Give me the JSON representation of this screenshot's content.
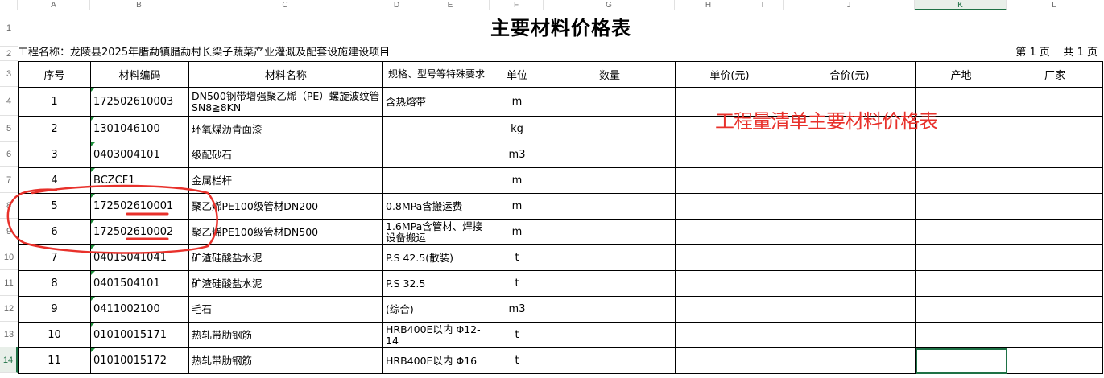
{
  "columns": [
    "A",
    "B",
    "C",
    "D",
    "E",
    "F",
    "G",
    "H",
    "I",
    "J",
    "K",
    "L"
  ],
  "selected_column": "K",
  "rows": [
    "1",
    "2",
    "3",
    "4",
    "5",
    "6",
    "7",
    "8",
    "9",
    "10",
    "11",
    "12",
    "13",
    "14"
  ],
  "selected_row": "14",
  "sheet": {
    "title": "主要材料价格表",
    "project": "工程名称：龙陵县2025年腊勐镇腊勐村长梁子蔬菜产业灌溉及配套设施建设项目",
    "page_info": "第 1 页    共 1 页",
    "headers": {
      "seq": "序号",
      "code": "材料编码",
      "name": "材料名称",
      "spec": "规格、型号等特殊要求",
      "unit": "单位",
      "qty": "数量",
      "price": "单价(元)",
      "total": "合价(元)",
      "origin": "产地",
      "maker": "厂家"
    },
    "items": [
      {
        "seq": "1",
        "code": "172502610003",
        "name": "DN500钢带增强聚乙烯（PE）螺旋波纹管SN8≧8KN",
        "spec": "含热熔带",
        "unit": "m"
      },
      {
        "seq": "2",
        "code": "1301046100",
        "name": "环氧煤沥青面漆",
        "spec": "",
        "unit": "kg"
      },
      {
        "seq": "3",
        "code": "0403004101",
        "name": "级配砂石",
        "spec": "",
        "unit": "m3"
      },
      {
        "seq": "4",
        "code": "BCZCF1",
        "name": "金属栏杆",
        "spec": "",
        "unit": "m"
      },
      {
        "seq": "5",
        "code": "172502610001",
        "name": "聚乙烯PE100级管材DN200",
        "spec": "0.8MPa含搬运费",
        "unit": "m"
      },
      {
        "seq": "6",
        "code": "172502610002",
        "name": "聚乙烯PE100级管材DN500",
        "spec": "1.6MPa含管材、焊接设备搬运",
        "unit": "m"
      },
      {
        "seq": "7",
        "code": "04015041041",
        "name": "矿渣硅酸盐水泥",
        "spec": "P.S 42.5(散装)",
        "unit": "t"
      },
      {
        "seq": "8",
        "code": "0401504101",
        "name": "矿渣硅酸盐水泥",
        "spec": "P.S 32.5",
        "unit": "t"
      },
      {
        "seq": "9",
        "code": "0411002100",
        "name": "毛石",
        "spec": "(综合)",
        "unit": "m3"
      },
      {
        "seq": "10",
        "code": "01010015171",
        "name": "热轧带肋钢筋",
        "spec": "HRB400E以内 Φ12-14",
        "unit": "t"
      },
      {
        "seq": "11",
        "code": "01010015172",
        "name": "热轧带肋钢筋",
        "spec": "HRB400E以内 Φ16",
        "unit": "t"
      }
    ]
  },
  "annotation": {
    "text": "工程量清单主要材料价格表",
    "color": "#e8312b"
  },
  "colors": {
    "accent": "#1e7145",
    "annotation_red": "#e8312b"
  }
}
